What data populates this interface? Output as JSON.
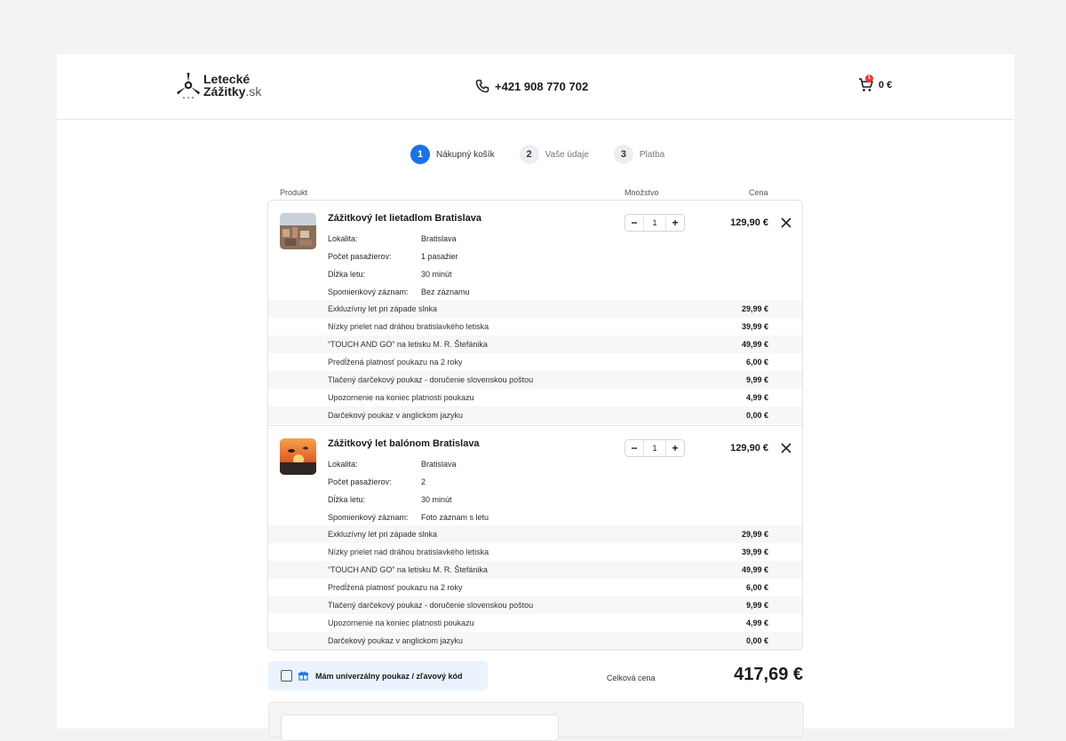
{
  "header": {
    "logo_line1": "Letecké",
    "logo_line2": "Zážitky",
    "logo_suffix": ".sk",
    "phone": "+421 908 770 702",
    "cart_count": "1",
    "cart_total": "0 €"
  },
  "steps": [
    {
      "num": "1",
      "label": "Nákupný košík",
      "active": true
    },
    {
      "num": "2",
      "label": "Vaše údaje",
      "active": false
    },
    {
      "num": "3",
      "label": "Platba",
      "active": false
    }
  ],
  "columns": {
    "product": "Produkt",
    "quantity": "Množstvo",
    "price": "Cena"
  },
  "products": [
    {
      "title": "Zážitkový let lietadlom Bratislava",
      "quantity": "1",
      "price": "129,90 €",
      "attributes": [
        {
          "label": "Lokalita:",
          "value": "Bratislava"
        },
        {
          "label": "Počet pasažierov:",
          "value": "1 pasažier"
        },
        {
          "label": "Dĺžka letu:",
          "value": "30 minút"
        },
        {
          "label": "Spomienkový záznam:",
          "value": "Bez záznamu"
        }
      ],
      "extras": [
        {
          "label": "Exkluzívny let pri západe slnka",
          "price": "29,99 €"
        },
        {
          "label": "Nízky prielet nad dráhou bratislavkého letiska",
          "price": "39,99 €"
        },
        {
          "label": "“TOUCH AND GO” na letisku M. R. Štefánika",
          "price": "49,99 €"
        },
        {
          "label": "Predĺžená platnosť poukazu na 2 roky",
          "price": "6,00 €"
        },
        {
          "label": "Tlačený darčekový poukaz - doručenie slovenskou poštou",
          "price": "9,99 €"
        },
        {
          "label": "Upozornenie na koniec platnosti poukazu",
          "price": "4,99 €"
        },
        {
          "label": "Darčekový poukaz v anglickom jazyku",
          "price": "0,00 €"
        }
      ]
    },
    {
      "title": "Zážitkový let balónom Bratislava",
      "quantity": "1",
      "price": "129,90 €",
      "attributes": [
        {
          "label": "Lokalita:",
          "value": "Bratislava"
        },
        {
          "label": "Počet pasažierov:",
          "value": "2"
        },
        {
          "label": "Dĺžka letu:",
          "value": "30 minút"
        },
        {
          "label": "Spomienkový záznam:",
          "value": "Foto záznam s letu"
        }
      ],
      "extras": [
        {
          "label": "Exkluzívny let pri západe slnka",
          "price": "29,99 €"
        },
        {
          "label": "Nízky prielet nad dráhou bratislavkého letiska",
          "price": "39,99 €"
        },
        {
          "label": "“TOUCH AND GO” na letisku M. R. Štefánika",
          "price": "49,99 €"
        },
        {
          "label": "Predĺžená platnosť poukazu na 2 roky",
          "price": "6,00 €"
        },
        {
          "label": "Tlačený darčekový poukaz - doručenie slovenskou poštou",
          "price": "9,99 €"
        },
        {
          "label": "Upozornenie na koniec platnosti poukazu",
          "price": "4,99 €"
        },
        {
          "label": "Darčekový poukaz v anglickom jazyku",
          "price": "0,00 €"
        }
      ]
    }
  ],
  "voucher_label": "Mám univerzálny poukaz / zľavový kód",
  "total_label": "Celková cena",
  "total_value": "417,69 €",
  "colors": {
    "accent": "#1a73e8",
    "badge": "#e53935",
    "voucher_bg": "#eaf3fd"
  }
}
